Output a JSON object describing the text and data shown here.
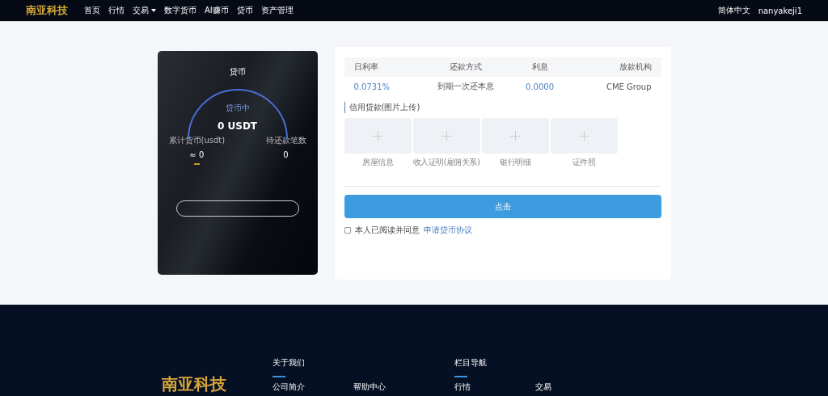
{
  "nav": {
    "logo": "南亚科技",
    "items": [
      {
        "label": "首页",
        "dropdown": false
      },
      {
        "label": "行情",
        "dropdown": false
      },
      {
        "label": "交易",
        "dropdown": true
      },
      {
        "label": "数字货币",
        "dropdown": false
      },
      {
        "label": "AI赚币",
        "dropdown": false
      },
      {
        "label": "贷币",
        "dropdown": false
      },
      {
        "label": "资产管理",
        "dropdown": false
      }
    ],
    "language": "简体中文",
    "user": "nanyakeji1"
  },
  "loan_card": {
    "title": "贷币",
    "gauge_label": "贷币中",
    "amount": "0 USDT",
    "stats": [
      {
        "label": "累计货币(usdt)",
        "value": "≈ 0"
      },
      {
        "label": "待还款笔数",
        "value": "0"
      }
    ]
  },
  "terms": {
    "columns": [
      "日利率",
      "还款方式",
      "利息",
      "放款机构"
    ],
    "row": [
      "0.0731%",
      "到期一次还本息",
      "0.0000",
      "CME Group"
    ]
  },
  "upload": {
    "title": "信用贷款(图片上传)",
    "slots": [
      "房屋信息",
      "收入证明(雇佣关系)",
      "银行明细",
      "证件照"
    ]
  },
  "submit": "点击",
  "agreement": {
    "checked": false,
    "text": "本人已阅读并同意",
    "link": "申请贷币协议"
  },
  "footer": {
    "logo": "南亚科技",
    "sections": [
      {
        "title": "关于我们",
        "links": [
          "公司简介",
          "帮助中心"
        ]
      },
      {
        "title": "栏目导航",
        "links": [
          "行情",
          "交易"
        ]
      }
    ]
  }
}
